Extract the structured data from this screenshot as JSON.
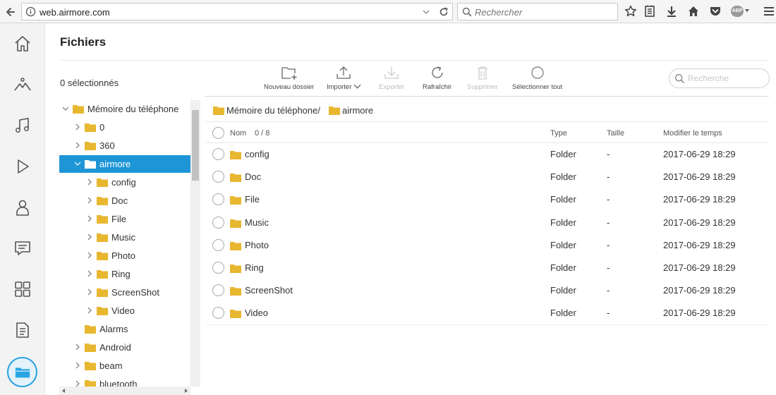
{
  "browser": {
    "url": "web.airmore.com",
    "search_placeholder": "Rechercher",
    "abp_label": "ABP"
  },
  "page": {
    "title": "Fichiers",
    "selected_count": "0 sélectionnés"
  },
  "toolbar": {
    "new_folder": "Nouveau dossier",
    "import": "Importer",
    "export": "Exporter",
    "refresh": "Rafraîchir",
    "delete": "Supprimer",
    "select_all": "Sélectionner tout"
  },
  "search": {
    "placeholder": "Recherche"
  },
  "tree": {
    "root": "Mémoire du téléphone",
    "items": [
      {
        "label": "0"
      },
      {
        "label": "360"
      },
      {
        "label": "airmore",
        "selected": true
      },
      {
        "label": "config"
      },
      {
        "label": "Doc"
      },
      {
        "label": "File"
      },
      {
        "label": "Music"
      },
      {
        "label": "Photo"
      },
      {
        "label": "Ring"
      },
      {
        "label": "ScreenShot"
      },
      {
        "label": "Video"
      },
      {
        "label": "Alarms"
      },
      {
        "label": "Android"
      },
      {
        "label": "beam"
      },
      {
        "label": "bluetooth"
      }
    ]
  },
  "breadcrumb": {
    "root": "Mémoire du téléphone/",
    "current": "airmore"
  },
  "list": {
    "headers": {
      "name": "Nom",
      "count": "0 / 8",
      "type": "Type",
      "size": "Taille",
      "modified": "Modifier le temps"
    },
    "rows": [
      {
        "name": "config",
        "type": "Folder",
        "size": "-",
        "modified": "2017-06-29 18:29"
      },
      {
        "name": "Doc",
        "type": "Folder",
        "size": "-",
        "modified": "2017-06-29 18:29"
      },
      {
        "name": "File",
        "type": "Folder",
        "size": "-",
        "modified": "2017-06-29 18:29"
      },
      {
        "name": "Music",
        "type": "Folder",
        "size": "-",
        "modified": "2017-06-29 18:29"
      },
      {
        "name": "Photo",
        "type": "Folder",
        "size": "-",
        "modified": "2017-06-29 18:29"
      },
      {
        "name": "Ring",
        "type": "Folder",
        "size": "-",
        "modified": "2017-06-29 18:29"
      },
      {
        "name": "ScreenShot",
        "type": "Folder",
        "size": "-",
        "modified": "2017-06-29 18:29"
      },
      {
        "name": "Video",
        "type": "Folder",
        "size": "-",
        "modified": "2017-06-29 18:29"
      }
    ]
  },
  "colors": {
    "accent": "#1e96d5",
    "folder": "#e8b730"
  },
  "rail_icons": [
    "home-icon",
    "photos-icon",
    "music-icon",
    "video-icon",
    "contacts-icon",
    "messages-icon",
    "apps-icon",
    "documents-icon",
    "files-icon"
  ]
}
